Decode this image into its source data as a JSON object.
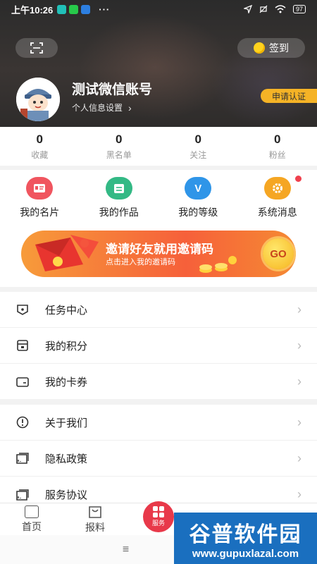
{
  "status_bar": {
    "time": "上午10:26",
    "dots": "···",
    "battery": "97"
  },
  "header": {
    "signin_label": "签到",
    "nickname": "测试微信账号",
    "profile_settings": "个人信息设置",
    "apply_cert_label": "申请认证"
  },
  "stats": [
    {
      "value": "0",
      "label": "收藏"
    },
    {
      "value": "0",
      "label": "黑名单"
    },
    {
      "value": "0",
      "label": "关注"
    },
    {
      "value": "0",
      "label": "粉丝"
    }
  ],
  "features": [
    {
      "label": "我的名片",
      "icon": "card-icon",
      "color": "#f0555f"
    },
    {
      "label": "我的作品",
      "icon": "works-icon",
      "color": "#33b985"
    },
    {
      "label": "我的等级",
      "icon": "level-icon",
      "color": "#2f95e8",
      "glyph": "V"
    },
    {
      "label": "系统消息",
      "icon": "gear-icon",
      "color": "#f5a623",
      "has_badge": true
    }
  ],
  "banner": {
    "title": "邀请好友就用邀请码",
    "subtitle": "点击进入我的邀请码",
    "go_label": "GO"
  },
  "menu_group_1": [
    {
      "label": "任务中心",
      "icon": "task-icon"
    },
    {
      "label": "我的积分",
      "icon": "points-icon"
    },
    {
      "label": "我的卡券",
      "icon": "coupon-icon"
    }
  ],
  "menu_group_2": [
    {
      "label": "关于我们",
      "icon": "info-icon"
    },
    {
      "label": "隐私政策",
      "icon": "privacy-icon"
    },
    {
      "label": "服务协议",
      "icon": "agreement-icon"
    }
  ],
  "tabbar": {
    "home": "首页",
    "news": "报料",
    "service": "服务"
  },
  "watermark": {
    "text": "谷普软件园",
    "url": "www.gupuxlazal.com"
  },
  "colors": {
    "accent": "#e8394a",
    "gold": "#f5b326",
    "banner": "#f6603a"
  }
}
